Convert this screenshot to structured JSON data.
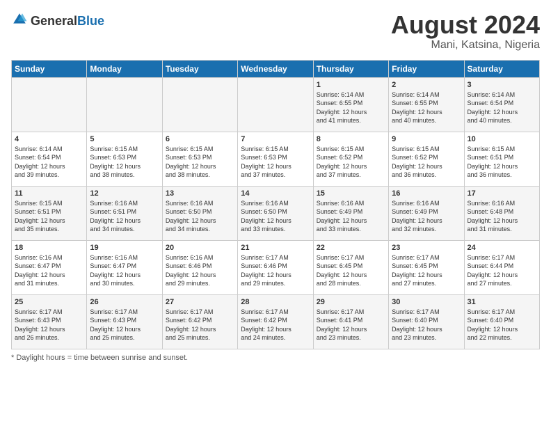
{
  "header": {
    "logo_general": "General",
    "logo_blue": "Blue",
    "month_year": "August 2024",
    "location": "Mani, Katsina, Nigeria"
  },
  "days_of_week": [
    "Sunday",
    "Monday",
    "Tuesday",
    "Wednesday",
    "Thursday",
    "Friday",
    "Saturday"
  ],
  "footer": {
    "daylight_hours_label": "Daylight hours"
  },
  "weeks": [
    [
      {
        "day": "",
        "content": ""
      },
      {
        "day": "",
        "content": ""
      },
      {
        "day": "",
        "content": ""
      },
      {
        "day": "",
        "content": ""
      },
      {
        "day": "1",
        "content": "Sunrise: 6:14 AM\nSunset: 6:55 PM\nDaylight: 12 hours\nand 41 minutes."
      },
      {
        "day": "2",
        "content": "Sunrise: 6:14 AM\nSunset: 6:55 PM\nDaylight: 12 hours\nand 40 minutes."
      },
      {
        "day": "3",
        "content": "Sunrise: 6:14 AM\nSunset: 6:54 PM\nDaylight: 12 hours\nand 40 minutes."
      }
    ],
    [
      {
        "day": "4",
        "content": "Sunrise: 6:14 AM\nSunset: 6:54 PM\nDaylight: 12 hours\nand 39 minutes."
      },
      {
        "day": "5",
        "content": "Sunrise: 6:15 AM\nSunset: 6:53 PM\nDaylight: 12 hours\nand 38 minutes."
      },
      {
        "day": "6",
        "content": "Sunrise: 6:15 AM\nSunset: 6:53 PM\nDaylight: 12 hours\nand 38 minutes."
      },
      {
        "day": "7",
        "content": "Sunrise: 6:15 AM\nSunset: 6:53 PM\nDaylight: 12 hours\nand 37 minutes."
      },
      {
        "day": "8",
        "content": "Sunrise: 6:15 AM\nSunset: 6:52 PM\nDaylight: 12 hours\nand 37 minutes."
      },
      {
        "day": "9",
        "content": "Sunrise: 6:15 AM\nSunset: 6:52 PM\nDaylight: 12 hours\nand 36 minutes."
      },
      {
        "day": "10",
        "content": "Sunrise: 6:15 AM\nSunset: 6:51 PM\nDaylight: 12 hours\nand 36 minutes."
      }
    ],
    [
      {
        "day": "11",
        "content": "Sunrise: 6:15 AM\nSunset: 6:51 PM\nDaylight: 12 hours\nand 35 minutes."
      },
      {
        "day": "12",
        "content": "Sunrise: 6:16 AM\nSunset: 6:51 PM\nDaylight: 12 hours\nand 34 minutes."
      },
      {
        "day": "13",
        "content": "Sunrise: 6:16 AM\nSunset: 6:50 PM\nDaylight: 12 hours\nand 34 minutes."
      },
      {
        "day": "14",
        "content": "Sunrise: 6:16 AM\nSunset: 6:50 PM\nDaylight: 12 hours\nand 33 minutes."
      },
      {
        "day": "15",
        "content": "Sunrise: 6:16 AM\nSunset: 6:49 PM\nDaylight: 12 hours\nand 33 minutes."
      },
      {
        "day": "16",
        "content": "Sunrise: 6:16 AM\nSunset: 6:49 PM\nDaylight: 12 hours\nand 32 minutes."
      },
      {
        "day": "17",
        "content": "Sunrise: 6:16 AM\nSunset: 6:48 PM\nDaylight: 12 hours\nand 31 minutes."
      }
    ],
    [
      {
        "day": "18",
        "content": "Sunrise: 6:16 AM\nSunset: 6:47 PM\nDaylight: 12 hours\nand 31 minutes."
      },
      {
        "day": "19",
        "content": "Sunrise: 6:16 AM\nSunset: 6:47 PM\nDaylight: 12 hours\nand 30 minutes."
      },
      {
        "day": "20",
        "content": "Sunrise: 6:16 AM\nSunset: 6:46 PM\nDaylight: 12 hours\nand 29 minutes."
      },
      {
        "day": "21",
        "content": "Sunrise: 6:17 AM\nSunset: 6:46 PM\nDaylight: 12 hours\nand 29 minutes."
      },
      {
        "day": "22",
        "content": "Sunrise: 6:17 AM\nSunset: 6:45 PM\nDaylight: 12 hours\nand 28 minutes."
      },
      {
        "day": "23",
        "content": "Sunrise: 6:17 AM\nSunset: 6:45 PM\nDaylight: 12 hours\nand 27 minutes."
      },
      {
        "day": "24",
        "content": "Sunrise: 6:17 AM\nSunset: 6:44 PM\nDaylight: 12 hours\nand 27 minutes."
      }
    ],
    [
      {
        "day": "25",
        "content": "Sunrise: 6:17 AM\nSunset: 6:43 PM\nDaylight: 12 hours\nand 26 minutes."
      },
      {
        "day": "26",
        "content": "Sunrise: 6:17 AM\nSunset: 6:43 PM\nDaylight: 12 hours\nand 25 minutes."
      },
      {
        "day": "27",
        "content": "Sunrise: 6:17 AM\nSunset: 6:42 PM\nDaylight: 12 hours\nand 25 minutes."
      },
      {
        "day": "28",
        "content": "Sunrise: 6:17 AM\nSunset: 6:42 PM\nDaylight: 12 hours\nand 24 minutes."
      },
      {
        "day": "29",
        "content": "Sunrise: 6:17 AM\nSunset: 6:41 PM\nDaylight: 12 hours\nand 23 minutes."
      },
      {
        "day": "30",
        "content": "Sunrise: 6:17 AM\nSunset: 6:40 PM\nDaylight: 12 hours\nand 23 minutes."
      },
      {
        "day": "31",
        "content": "Sunrise: 6:17 AM\nSunset: 6:40 PM\nDaylight: 12 hours\nand 22 minutes."
      }
    ]
  ]
}
